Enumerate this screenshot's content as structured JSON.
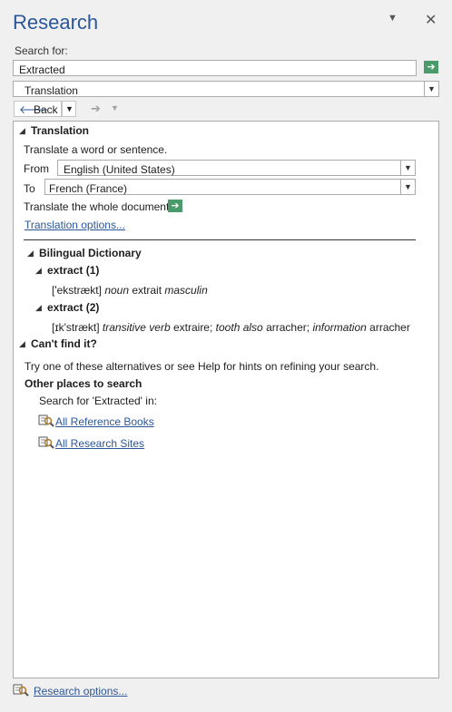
{
  "pane": {
    "title": "Research"
  },
  "search": {
    "label": "Search for:",
    "value": "Extracted",
    "service": "Translation"
  },
  "nav": {
    "back_label": "Back"
  },
  "translation": {
    "heading": "Translation",
    "instruction": "Translate a word or sentence.",
    "from_label": "From",
    "from_value": "English (United States)",
    "to_label": "To",
    "to_value": "French (France)",
    "whole_doc": "Translate the whole document.",
    "options_link": "Translation options..."
  },
  "dictionary": {
    "heading": "Bilingual Dictionary",
    "entries": [
      {
        "heading": "extract (1)",
        "pron": "['ekstrækt]",
        "pos": "noun",
        "word": "extrait",
        "gender": "masculin"
      },
      {
        "heading": "extract (2)",
        "pron": "[ɪk'strækt]",
        "pos1": "transitive verb",
        "word1": "extraire;",
        "ctx1": "tooth also",
        "word2": "arracher;",
        "ctx2": "information",
        "word3": "arracher"
      }
    ]
  },
  "cantfind": {
    "heading": "Can't find it?",
    "hint": "Try one of these alternatives or see Help for hints on refining your search.",
    "other_heading": "Other places to search",
    "search_for": "Search for 'Extracted' in:",
    "links": [
      "All Reference Books",
      "All Research Sites"
    ]
  },
  "footer": {
    "options_link": "Research options..."
  },
  "colors": {
    "accent": "#2b579a",
    "go_button": "#4a9a6a"
  }
}
